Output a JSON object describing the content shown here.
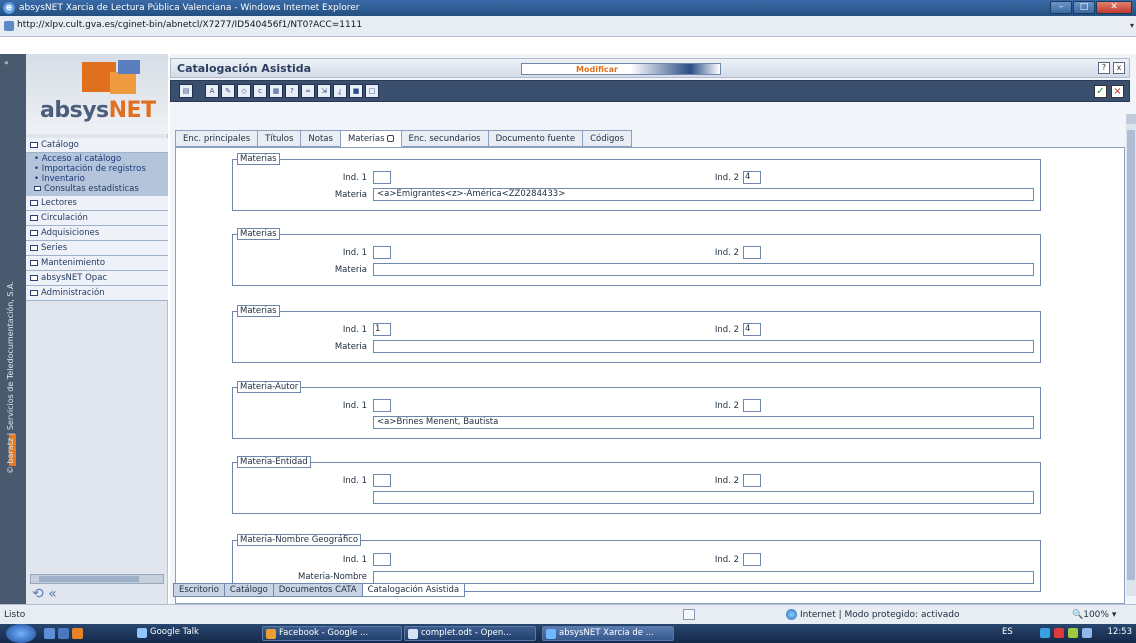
{
  "window": {
    "title": "absysNET Xarcia de Lectura Pública Valenciana - Windows Internet Explorer",
    "url": "http://xlpv.cult.gva.es/cginet-bin/abnetcl/X7277/ID540456f1/NT0?ACC=1111"
  },
  "sidebar": {
    "logo_text_main": "absys",
    "logo_text_accent": "NET",
    "vertical_credit": "© baratz | Servicios de Teledocumentación, S.A.",
    "catalog_label": "Catálogo",
    "catalog_subitems": [
      "• Acceso al catálogo",
      "• Importación de registros",
      "• Inventario",
      "Consultas estadísticas"
    ],
    "items": [
      "Lectores",
      "Circulación",
      "Adquisiciones",
      "Series",
      "Mantenimiento",
      "absysNET Opac",
      "Administración"
    ]
  },
  "header": {
    "title": "Catalogación Asistida",
    "mode": "Modificar",
    "help_button": "?",
    "close_button": "x"
  },
  "toolbar": {
    "ok": "✓",
    "cancel": "×"
  },
  "tabs": [
    {
      "label": "Enc. principales"
    },
    {
      "label": "Títulos"
    },
    {
      "label": "Notas"
    },
    {
      "label": "Materias"
    },
    {
      "label": "Enc. secundarios"
    },
    {
      "label": "Documento fuente"
    },
    {
      "label": "Códigos"
    }
  ],
  "groups": [
    {
      "legend": "Materias",
      "ind1_label": "Ind. 1",
      "ind1": "",
      "ind2_label": "Ind. 2",
      "ind2": "4",
      "field_label": "Materia",
      "field_value": "<a>Emigrantes<z>-América<ZZ0284433>"
    },
    {
      "legend": "Materias",
      "ind1_label": "Ind. 1",
      "ind1": "",
      "ind2_label": "Ind. 2",
      "ind2": "",
      "field_label": "Materia",
      "field_value": ""
    },
    {
      "legend": "Materias",
      "ind1_label": "Ind. 1",
      "ind1": "1",
      "ind2_label": "Ind. 2",
      "ind2": "4",
      "field_label": "Materia",
      "field_value": ""
    },
    {
      "legend": "Materia-Autor",
      "ind1_label": "Ind. 1",
      "ind1": "",
      "ind2_label": "Ind. 2",
      "ind2": "",
      "field_label": "",
      "field_value": "<a>Brines Menent, Bautista"
    },
    {
      "legend": "Materia-Entidad",
      "ind1_label": "Ind. 1",
      "ind1": "",
      "ind2_label": "Ind. 2",
      "ind2": "",
      "field_label": "",
      "field_value": ""
    },
    {
      "legend": "Materia-Nombre Geográfico",
      "ind1_label": "Ind. 1",
      "ind1": "",
      "ind2_label": "Ind. 2",
      "ind2": "",
      "field_label": "Materia-Nombre",
      "field_value": ""
    }
  ],
  "bottom_tabs": [
    {
      "label": "Escritorio"
    },
    {
      "label": "Catálogo"
    },
    {
      "label": "Documentos CATA"
    },
    {
      "label": "Catalogación Asistida"
    }
  ],
  "statusbar": {
    "text": "Listo",
    "zone": "Internet | Modo protegido: activado",
    "zoom": "100%"
  },
  "taskbar": {
    "tasks": [
      "Google Talk",
      "Facebook - Google ...",
      "complet.odt - Open...",
      "absysNET Xarcia de ..."
    ],
    "language": "ES",
    "clock": "12:53"
  },
  "colors": {
    "accent_orange": "#e07020",
    "nav_blue": "#3a4e6e",
    "border_blue": "#6f87ad"
  }
}
